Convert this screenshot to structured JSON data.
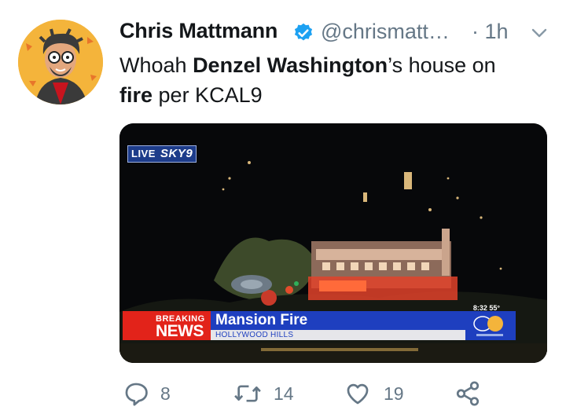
{
  "tweet": {
    "author_name": "Chris Mattmann",
    "handle": "@chrismatt…",
    "time": "· 1h",
    "text_parts": [
      "Whoah ",
      "Denzel Washington",
      "’s house on ",
      "fire",
      " per KCAL9"
    ],
    "bold_parts": [
      1,
      3
    ]
  },
  "media": {
    "live_badge_live": "LIVE",
    "live_badge_sky": "SKY9",
    "clock": "8:32  55°",
    "breaking_top": "BREAKING",
    "breaking_bottom": "NEWS",
    "headline": "Mansion Fire",
    "subheadline": "HOLLYWOOD HILLS",
    "station": "KCAL 9"
  },
  "actions": {
    "reply_count": "8",
    "retweet_count": "14",
    "like_count": "19"
  },
  "icons": {
    "verified": "verified-badge-icon",
    "menu": "chevron-down-icon",
    "reply": "reply-icon",
    "retweet": "retweet-icon",
    "like": "heart-icon",
    "share": "share-icon"
  },
  "colors": {
    "verified_blue": "#1da1f2",
    "meta_gray": "#657786",
    "breaking_red": "#e2231a",
    "news_blue": "#1e3fbf",
    "avatar_bg": "#f4b43b"
  }
}
